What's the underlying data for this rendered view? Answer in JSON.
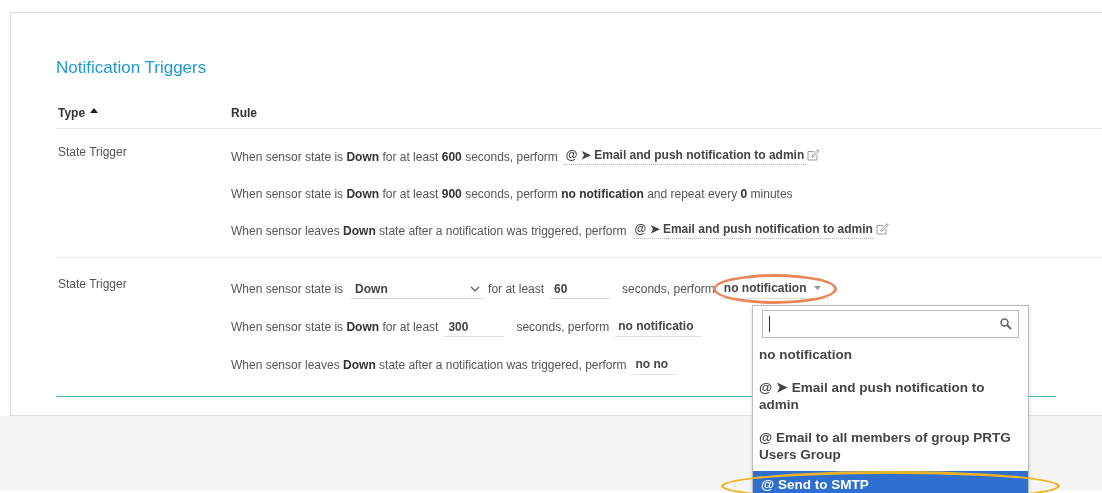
{
  "panel": {
    "title": "Notification Triggers"
  },
  "table": {
    "columns": [
      {
        "label": "Type",
        "sorted": true
      },
      {
        "label": "Rule",
        "sorted": false
      }
    ],
    "rows": [
      {
        "type": "State Trigger",
        "rules": [
          [
            {
              "kind": "text",
              "text": "When sensor state is **Down** for at least **600** seconds, perform"
            },
            {
              "kind": "link",
              "text": "@ ➤ Email and push notification to admin"
            },
            {
              "kind": "edit"
            }
          ],
          [
            {
              "kind": "text",
              "text": "When sensor state is **Down** for at least **900** seconds, perform **no notification** and repeat every **0** minutes"
            }
          ],
          [
            {
              "kind": "text",
              "text": "When sensor leaves **Down** state after a notification was triggered, perform"
            },
            {
              "kind": "link",
              "text": "@ ➤ Email and push notification to admin"
            },
            {
              "kind": "edit"
            }
          ]
        ]
      },
      {
        "type": "State Trigger",
        "rules": [
          [
            {
              "kind": "text",
              "text": "When sensor state is"
            },
            {
              "kind": "select",
              "value": "Down"
            },
            {
              "kind": "text",
              "text": "for at least"
            },
            {
              "kind": "input",
              "value": "60"
            },
            {
              "kind": "text",
              "text": "seconds, perform"
            },
            {
              "kind": "action",
              "value": "no notification",
              "highlight": {
                "color": "#e8875a"
              }
            }
          ],
          [
            {
              "kind": "text",
              "text": "When sensor state is **Down** for at least"
            },
            {
              "kind": "input",
              "value": "300"
            },
            {
              "kind": "text",
              "text": "seconds, perform"
            },
            {
              "kind": "action_cut",
              "value": "no notificatio"
            }
          ],
          [
            {
              "kind": "text",
              "text": "When sensor leaves **Down** state after a notification was triggered, perform"
            },
            {
              "kind": "action_cut",
              "value": "no no"
            }
          ]
        ]
      }
    ]
  },
  "dropdown": {
    "search": {
      "focused": true
    },
    "options": [
      {
        "text": "no notification",
        "selected": false
      },
      {
        "text": "@ ➤ Email and push notification to admin",
        "selected": false
      },
      {
        "text": "@ Email to all members of group PRTG Users Group",
        "selected": false
      },
      {
        "text": "@ Send to SMTP",
        "selected": true,
        "highlight": {
          "color": "#f0b429"
        }
      }
    ]
  }
}
